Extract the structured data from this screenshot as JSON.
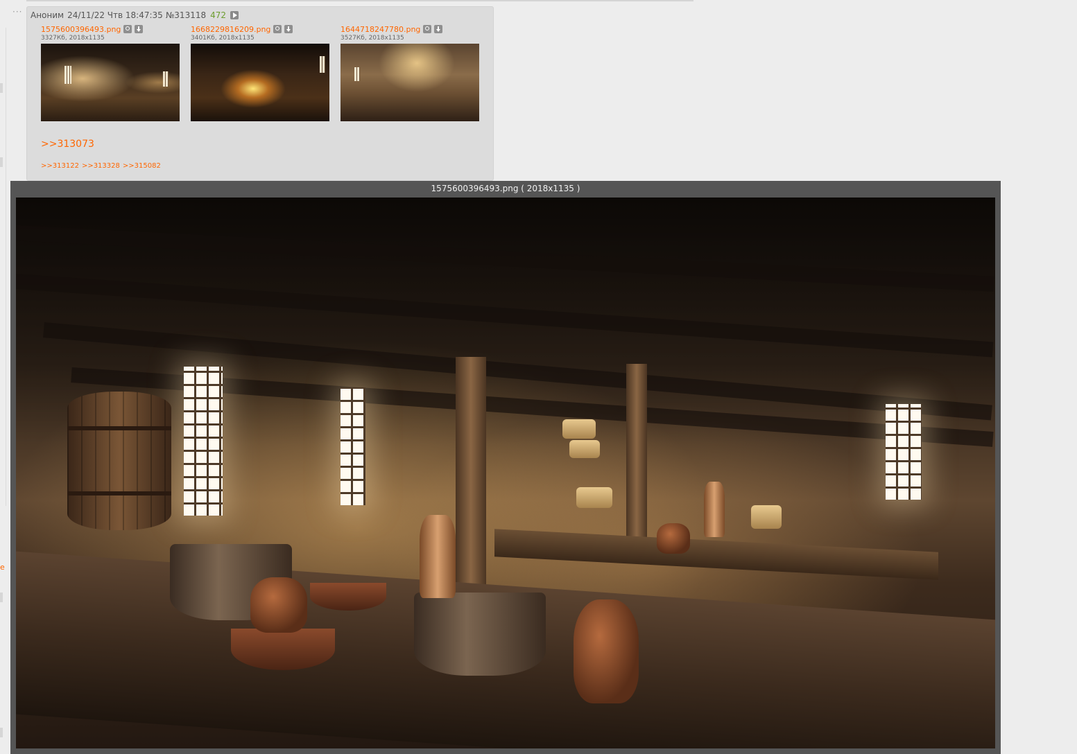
{
  "post": {
    "menu_dots": "···",
    "author": "Аноним",
    "datetime": "24/11/22 Чтв 18:47:35",
    "number": "№313118",
    "count": "472",
    "files": [
      {
        "name": "1575600396493.png",
        "meta": "3327Кб, 2018x1135"
      },
      {
        "name": "1668229816209.png",
        "meta": "3401Кб, 2018x1135"
      },
      {
        "name": "1644718247780.png",
        "meta": "3527Кб, 2018x1135"
      }
    ],
    "reply_link": ">>313073",
    "backlinks": [
      ">>313122",
      ">>313328",
      ">>315082"
    ]
  },
  "viewer": {
    "title": "1575600396493.png ( 2018x1135 )"
  },
  "left_edge": {
    "cut_letter": "e"
  }
}
